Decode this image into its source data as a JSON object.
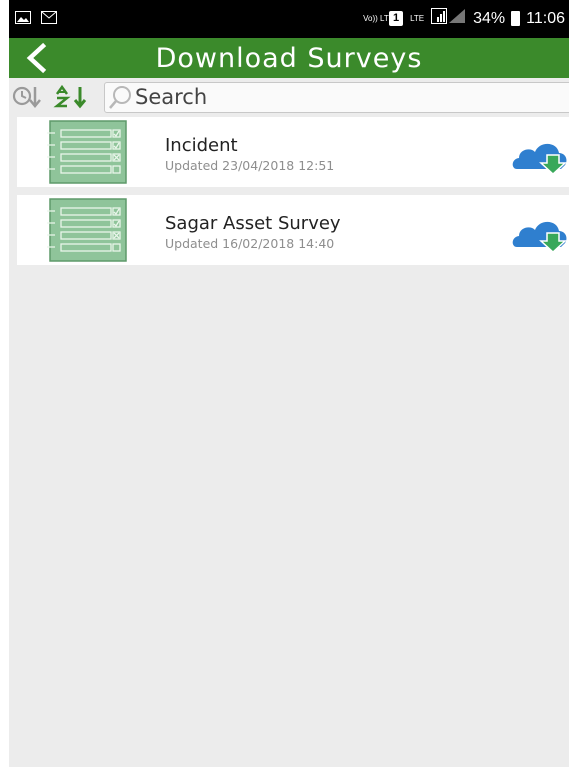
{
  "status_bar": {
    "volte": "Vo)) LTE",
    "sim": "1",
    "network": "LTE",
    "battery": "34%",
    "time": "11:06"
  },
  "header": {
    "title": "Download Surveys",
    "bar_color": "#3b8a2b"
  },
  "toolbar": {
    "search_placeholder": "Search"
  },
  "surveys": [
    {
      "title": "Incident",
      "updated": "Updated 23/04/2018 12:51",
      "icon": "cloud-download-icon"
    },
    {
      "title": "Sagar Asset Survey",
      "updated": "Updated 16/02/2018 14:40",
      "icon": "cloud-download-icon"
    }
  ]
}
